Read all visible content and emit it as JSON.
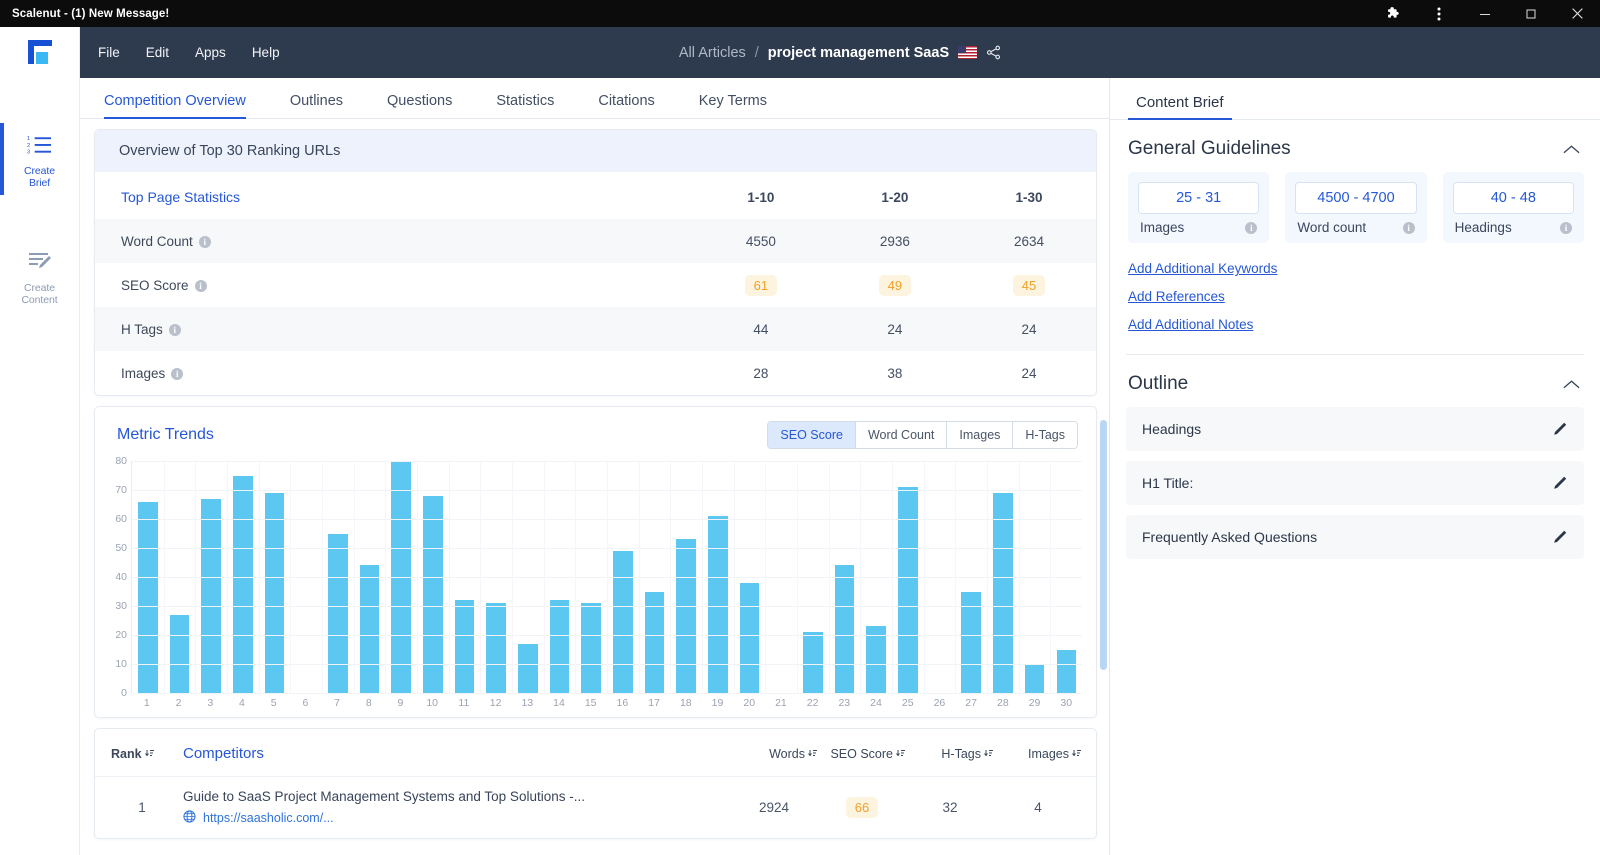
{
  "window": {
    "title": "Scalenut - (1) New Message!",
    "controls": [
      "puzzle-extension",
      "more-options",
      "minimize",
      "maximize",
      "close"
    ]
  },
  "rail": {
    "logo": "scalenut-logo",
    "items": [
      {
        "label_line1": "Create",
        "label_line2": "Brief",
        "icon": "ordered-list-icon",
        "active": true
      },
      {
        "label_line1": "Create",
        "label_line2": "Content",
        "icon": "edit-document-icon",
        "active": false
      }
    ]
  },
  "topbar": {
    "menu": [
      "File",
      "Edit",
      "Apps",
      "Help"
    ],
    "breadcrumb_root": "All Articles",
    "breadcrumb_sep": "/",
    "breadcrumb_current": "project management SaaS",
    "flag": "us-flag-icon",
    "share": "share-icon"
  },
  "tabs": [
    {
      "label": "Competition Overview",
      "active": true
    },
    {
      "label": "Outlines",
      "active": false
    },
    {
      "label": "Questions",
      "active": false
    },
    {
      "label": "Statistics",
      "active": false
    },
    {
      "label": "Citations",
      "active": false
    },
    {
      "label": "Key Terms",
      "active": false
    }
  ],
  "overview": {
    "banner": "Overview of Top 30 Ranking URLs",
    "table": {
      "header": [
        "Top Page Statistics",
        "1-10",
        "1-20",
        "1-30"
      ],
      "rows": [
        {
          "label": "Word Count",
          "values": [
            "4550",
            "2936",
            "2634"
          ],
          "badge": false
        },
        {
          "label": "SEO Score",
          "values": [
            "61",
            "49",
            "45"
          ],
          "badge": true
        },
        {
          "label": "H Tags",
          "values": [
            "44",
            "24",
            "24"
          ],
          "badge": false
        },
        {
          "label": "Images",
          "values": [
            "28",
            "38",
            "24"
          ],
          "badge": false
        }
      ]
    }
  },
  "metric_trends": {
    "title": "Metric Trends",
    "segments": [
      {
        "label": "SEO Score",
        "active": true
      },
      {
        "label": "Word Count",
        "active": false
      },
      {
        "label": "Images",
        "active": false
      },
      {
        "label": "H-Tags",
        "active": false
      }
    ]
  },
  "chart_data": {
    "type": "bar",
    "title": "Metric Trends",
    "xlabel": "",
    "ylabel": "",
    "ylim": [
      0,
      80
    ],
    "yticks": [
      0,
      10,
      20,
      30,
      40,
      50,
      60,
      70,
      80
    ],
    "grid": true,
    "legend": "none",
    "series_name": "SEO Score",
    "bar_color": "#5cc8f2",
    "categories": [
      "1",
      "2",
      "3",
      "4",
      "5",
      "6",
      "7",
      "8",
      "9",
      "10",
      "11",
      "12",
      "13",
      "14",
      "15",
      "16",
      "17",
      "18",
      "19",
      "20",
      "21",
      "22",
      "23",
      "24",
      "25",
      "26",
      "27",
      "28",
      "29",
      "30"
    ],
    "values": [
      66,
      27,
      67,
      75,
      69,
      0,
      55,
      44,
      80,
      68,
      32,
      31,
      17,
      32,
      31,
      49,
      35,
      53,
      61,
      38,
      0,
      21,
      44,
      23,
      71,
      0,
      35,
      69,
      10,
      15
    ]
  },
  "competitors": {
    "columns": [
      {
        "label": "Rank",
        "sortable": true
      },
      {
        "label": "Competitors",
        "sortable": false
      },
      {
        "label": "Words",
        "sortable": true
      },
      {
        "label": "SEO Score",
        "sortable": true
      },
      {
        "label": "H-Tags",
        "sortable": true
      },
      {
        "label": "Images",
        "sortable": true
      }
    ],
    "rows": [
      {
        "rank": "1",
        "title": "Guide to SaaS Project Management Systems and Top Solutions -...",
        "url": "https://saasholic.com/...",
        "words": "2924",
        "seo_score": "66",
        "h_tags": "32",
        "images": "4"
      }
    ]
  },
  "content_brief": {
    "tab": "Content Brief",
    "general": {
      "title": "General Guidelines",
      "boxes": [
        {
          "value": "25 - 31",
          "label": "Images"
        },
        {
          "value": "4500 - 4700",
          "label": "Word count"
        },
        {
          "value": "40 - 48",
          "label": "Headings"
        }
      ],
      "links": [
        "Add Additional Keywords",
        "Add References",
        "Add Additional Notes"
      ]
    },
    "outline": {
      "title": "Outline",
      "items": [
        {
          "label": "Headings"
        },
        {
          "label": "H1 Title:"
        },
        {
          "label": "Frequently Asked Questions"
        }
      ]
    }
  },
  "colors": {
    "accent_blue": "#2557d6",
    "bar_blue": "#5cc8f2",
    "badge_bg": "#fdf4e0",
    "badge_text": "#f0a028",
    "topbar_bg": "#2e3a4e",
    "banner_bg": "#eef2fd"
  }
}
